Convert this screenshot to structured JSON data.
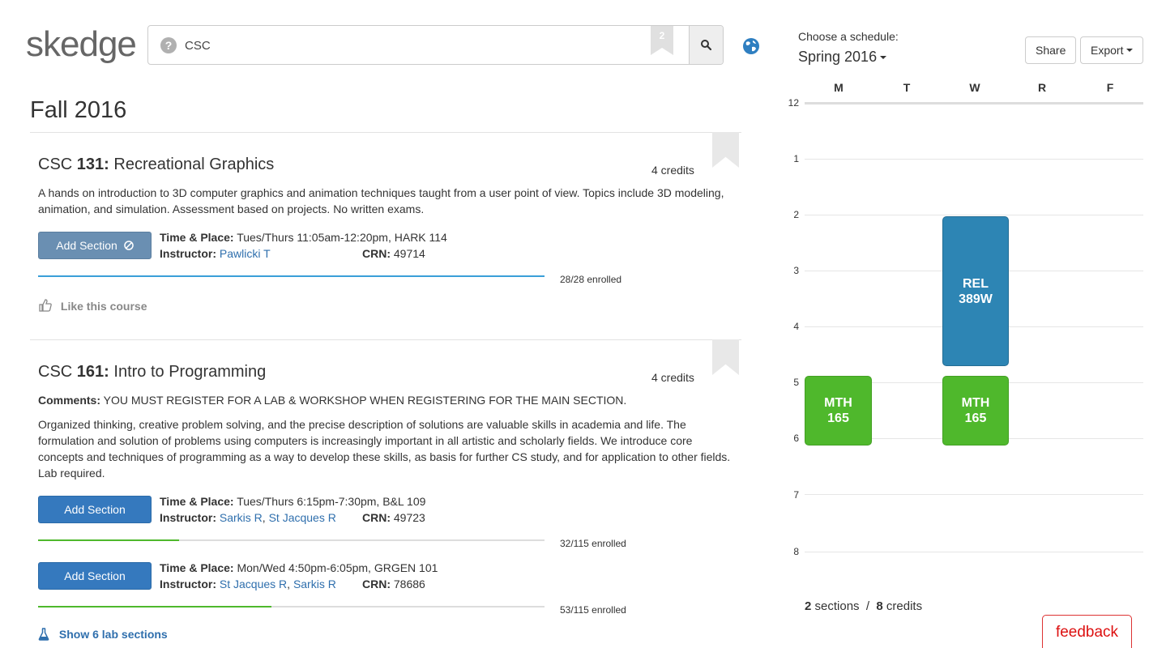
{
  "app": {
    "logo": "skedge"
  },
  "search": {
    "query": "CSC",
    "help_glyph": "?",
    "bookmark_count": "2"
  },
  "semester": "Fall 2016",
  "courses": [
    {
      "dept": "CSC",
      "number": "131:",
      "name": "Recreational Graphics",
      "credits": "4 credits",
      "description": "A hands on introduction to 3D computer graphics and animation techniques taught from a user point of view. Topics include 3D modeling, animation, and simulation. Assessment based on projects. No written exams.",
      "sections": [
        {
          "button": "Add Section",
          "time_label": "Time & Place:",
          "time": "Tues/Thurs 11:05am-12:20pm, HARK 114",
          "instructor_label": "Instructor:",
          "instructors": [
            "Pawlicki T"
          ],
          "crn_label": "CRN:",
          "crn": "49714",
          "enrolled": "28/28 enrolled",
          "fill": 1.0
        }
      ],
      "like": "Like this course"
    },
    {
      "dept": "CSC",
      "number": "161:",
      "name": "Intro to Programming",
      "credits": "4 credits",
      "comments_label": "Comments:",
      "comments": "YOU MUST REGISTER FOR A LAB & WORKSHOP WHEN REGISTERING FOR THE MAIN SECTION.",
      "description": "Organized thinking, creative problem solving, and the precise description of solutions are valuable skills in academia and life. The formulation and solution of problems using computers is increasingly important in all artistic and scholarly fields. We introduce core concepts and techniques of programming as a way to develop these skills, as basis for further CS study, and for application to other fields. Lab required.",
      "sections": [
        {
          "button": "Add Section",
          "time_label": "Time & Place:",
          "time": "Tues/Thurs 6:15pm-7:30pm, B&L 109",
          "instructor_label": "Instructor:",
          "instructors": [
            "Sarkis R",
            "St Jacques R"
          ],
          "crn_label": "CRN:",
          "crn": "49723",
          "enrolled": "32/115 enrolled",
          "fill": 0.278
        },
        {
          "button": "Add Section",
          "time_label": "Time & Place:",
          "time": "Mon/Wed 4:50pm-6:05pm, GRGEN 101",
          "instructor_label": "Instructor:",
          "instructors": [
            "St Jacques R",
            "Sarkis R"
          ],
          "crn_label": "CRN:",
          "crn": "78686",
          "enrolled": "53/115 enrolled",
          "fill": 0.461
        }
      ],
      "labs": "Show 6 lab sections"
    }
  ],
  "schedule": {
    "choose_label": "Choose a schedule:",
    "selected": "Spring 2016",
    "share": "Share",
    "export": "Export",
    "days": [
      "M",
      "T",
      "W",
      "R",
      "F"
    ],
    "hours": [
      "12",
      "1",
      "2",
      "3",
      "4",
      "5",
      "6",
      "7",
      "8"
    ],
    "blocks": [
      {
        "line1": "REL",
        "line2": "389W",
        "day": "W",
        "color": "#2d85b4"
      },
      {
        "line1": "MTH",
        "line2": "165",
        "day": "M",
        "color": "#4fb82c"
      },
      {
        "line1": "MTH",
        "line2": "165",
        "day": "W",
        "color": "#4fb82c"
      }
    ],
    "totals": {
      "sections_count": "2",
      "sections_label": "sections",
      "sep": "/",
      "credits_count": "8",
      "credits_label": "credits"
    }
  },
  "feedback": "feedback",
  "colors": {
    "accent": "#3579be",
    "progress_full": "#3a9fd8",
    "progress_partial": "#4fb82c",
    "feedback": "#d11111"
  }
}
